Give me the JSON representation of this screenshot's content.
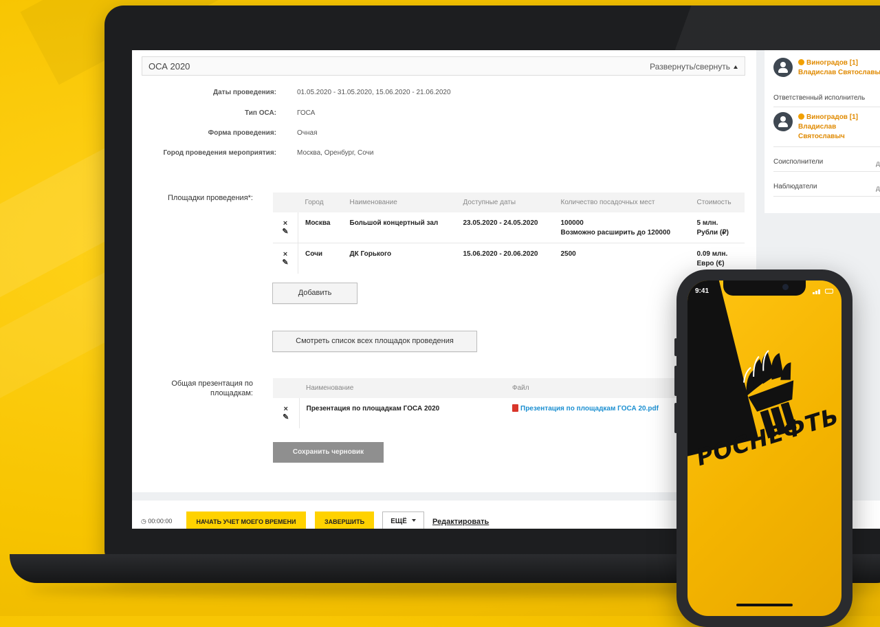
{
  "panel": {
    "title": "ОСА 2020",
    "toggle_label": "Развернуть/свернуть"
  },
  "details": [
    {
      "label": "Даты проведения:",
      "value": "01.05.2020 - 31.05.2020, 15.06.2020 - 21.06.2020"
    },
    {
      "label": "Тип ОСА:",
      "value": "ГОСА"
    },
    {
      "label": "Форма проведения:",
      "value": "Очная"
    },
    {
      "label": "Город проведения мероприятия:",
      "value": "Москва, Оренбург, Сочи"
    }
  ],
  "venues": {
    "label": "Площадки проведения*:",
    "columns": [
      "Город",
      "Наименование",
      "Доступные даты",
      "Количество посадочных мест",
      "Стоимость"
    ],
    "rows": [
      {
        "city": "Москва",
        "name": "Большой концертный зал",
        "dates": "23.05.2020 - 24.05.2020",
        "seats": "100000",
        "seats_note": "Возможно расширить до 120000",
        "cost": "5 млн.",
        "currency": "Рубли (₽)"
      },
      {
        "city": "Сочи",
        "name": "ДК Горького",
        "dates": "15.06.2020 - 20.06.2020",
        "seats": "2500",
        "seats_note": "",
        "cost": "0.09 млн.",
        "currency": "Евро (€)"
      }
    ],
    "delete_glyph": "×",
    "edit_glyph": "✎",
    "add_button": "Добавить",
    "view_all_button": "Смотреть список всех площадок проведения"
  },
  "presentation": {
    "label": "Общая презентация по площадкам:",
    "columns": [
      "Наименование",
      "Файл"
    ],
    "rows": [
      {
        "name": "Презентация по площадкам ГОСА 2020",
        "file": "Презентация по площадкам ГОСА 20.pdf"
      }
    ]
  },
  "save_draft_button": "Сохранить черновик",
  "toolbar": {
    "timer": "00:00:00",
    "start_tracking": "НАЧАТЬ УЧЕТ МОЕГО ВРЕМЕНИ",
    "finish": "ЗАВЕРШИТЬ",
    "more": "ЕЩЁ",
    "edit": "Редактировать"
  },
  "sidebar": {
    "person1_line1": "Виноградов [1]",
    "person1_line2": "Владислав Святославыч",
    "responsible_label": "Ответственный исполнитель",
    "person2_line1": "Виноградов [1]",
    "person2_line2": "Владислав",
    "person2_line3": "Святославыч",
    "coexecutors_label": "Соисполнители",
    "observers_label": "Наблюдатели",
    "right_truncated": "д"
  },
  "phone": {
    "time": "9:41",
    "brand": "РОСНЕФТЬ"
  },
  "colors": {
    "brand_yellow": "#ffd200",
    "link_blue": "#1b8fd1",
    "person_orange": "#e08a00",
    "sidebar_bg": "#eef0f2"
  }
}
